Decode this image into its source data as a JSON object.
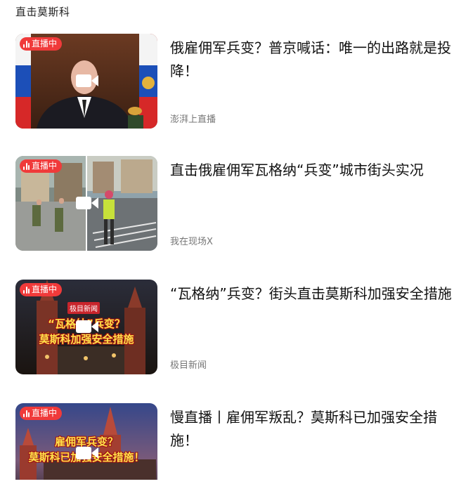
{
  "section": {
    "title": "直击莫斯科"
  },
  "items": [
    {
      "title": "俄雇佣军兵变？普京喊话：唯一的出路就是投降！",
      "source": "澎湃上直播",
      "badge": "直播中",
      "thumb_icon": "video-camera-icon"
    },
    {
      "title": "直击俄雇佣军瓦格纳“兵变”城市街头实况",
      "source": "我在现场X",
      "badge": "直播中",
      "thumb_icon": "video-camera-icon"
    },
    {
      "title": "“瓦格纳”兵变？街头直击莫斯科加强安全措施",
      "source": "极目新闻",
      "badge": "直播中",
      "thumb_logo": "极目新闻",
      "thumb_caption_1": "“瓦格纳”兵变？",
      "thumb_caption_2": "莫斯科加强安全措施",
      "thumb_icon": "video-camera-icon"
    },
    {
      "title": "慢直播丨雇佣军叛乱？莫斯科已加强安全措施！",
      "source": "",
      "badge": "直播中",
      "thumb_caption_1": "雇佣军兵变？",
      "thumb_caption_2": "莫斯科已加强安全措施！",
      "thumb_icon": "video-camera-icon"
    }
  ]
}
